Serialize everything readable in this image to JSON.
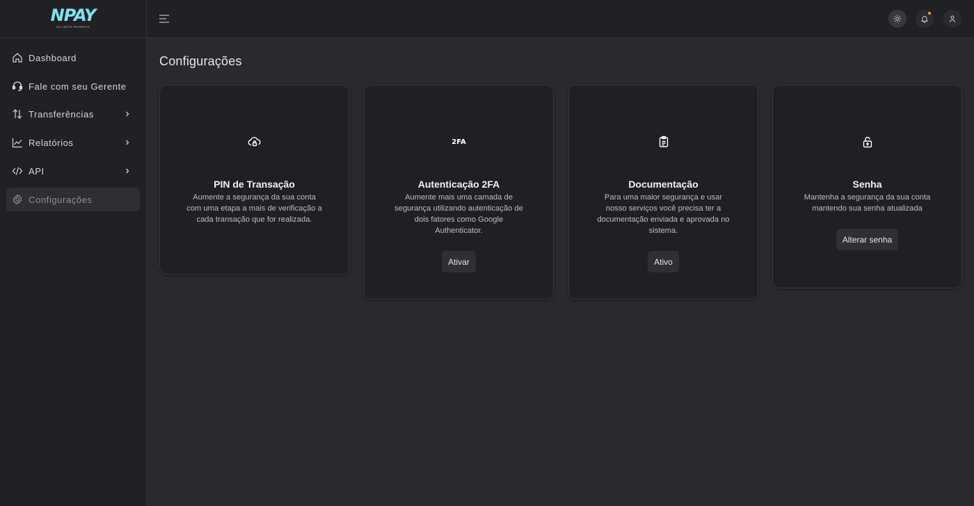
{
  "logo": {
    "text": "NPAY",
    "tagline": "NO LIMITS PAYMENTS"
  },
  "sidebar": {
    "items": [
      {
        "label": "Dashboard",
        "icon": "home-icon",
        "has_submenu": false,
        "active": false
      },
      {
        "label": "Fale com seu Gerente",
        "icon": "headset-icon",
        "has_submenu": false,
        "active": false
      },
      {
        "label": "Transferências",
        "icon": "transfer-arrows-icon",
        "has_submenu": true,
        "active": false
      },
      {
        "label": "Relatórios",
        "icon": "chart-line-icon",
        "has_submenu": true,
        "active": false
      },
      {
        "label": "API",
        "icon": "code-icon",
        "has_submenu": true,
        "active": false
      },
      {
        "label": "Configurações",
        "icon": "gear-icon",
        "has_submenu": false,
        "active": true
      }
    ]
  },
  "topbar": {
    "icons": [
      "menu-icon",
      "sun-icon",
      "bell-icon",
      "user-icon"
    ],
    "notification_dot_color": "#e0a23c"
  },
  "page": {
    "title": "Configurações"
  },
  "cards": [
    {
      "icon": "cloud-lock-icon",
      "title": "PIN de Transação",
      "description": "Aumente a segurança da sua conta com uma etapa a mais de verificação a cada transação que for realizada."
    },
    {
      "icon_text": "2FA",
      "title": "Autenticação 2FA",
      "description": "Aumente mais uma camada de segurança utilizando autenticação de dois fatores como Google Authenticator.",
      "button": "Ativar"
    },
    {
      "icon": "clipboard-icon",
      "title": "Documentação",
      "description": "Para uma maior segurança e usar nosso serviços você precisa ter a documentação enviada e aprovada no sistema.",
      "button": "Ativo"
    },
    {
      "icon": "unlock-icon",
      "title": "Senha",
      "description": "Mantenha a segurança da sua conta mantendo sua senha atualizada",
      "button": "Alterar senha"
    }
  ],
  "colors": {
    "background": "#2a2a2e",
    "sidebar": "#212125",
    "card": "#202024",
    "logo_accent": "#7fe3ef"
  }
}
